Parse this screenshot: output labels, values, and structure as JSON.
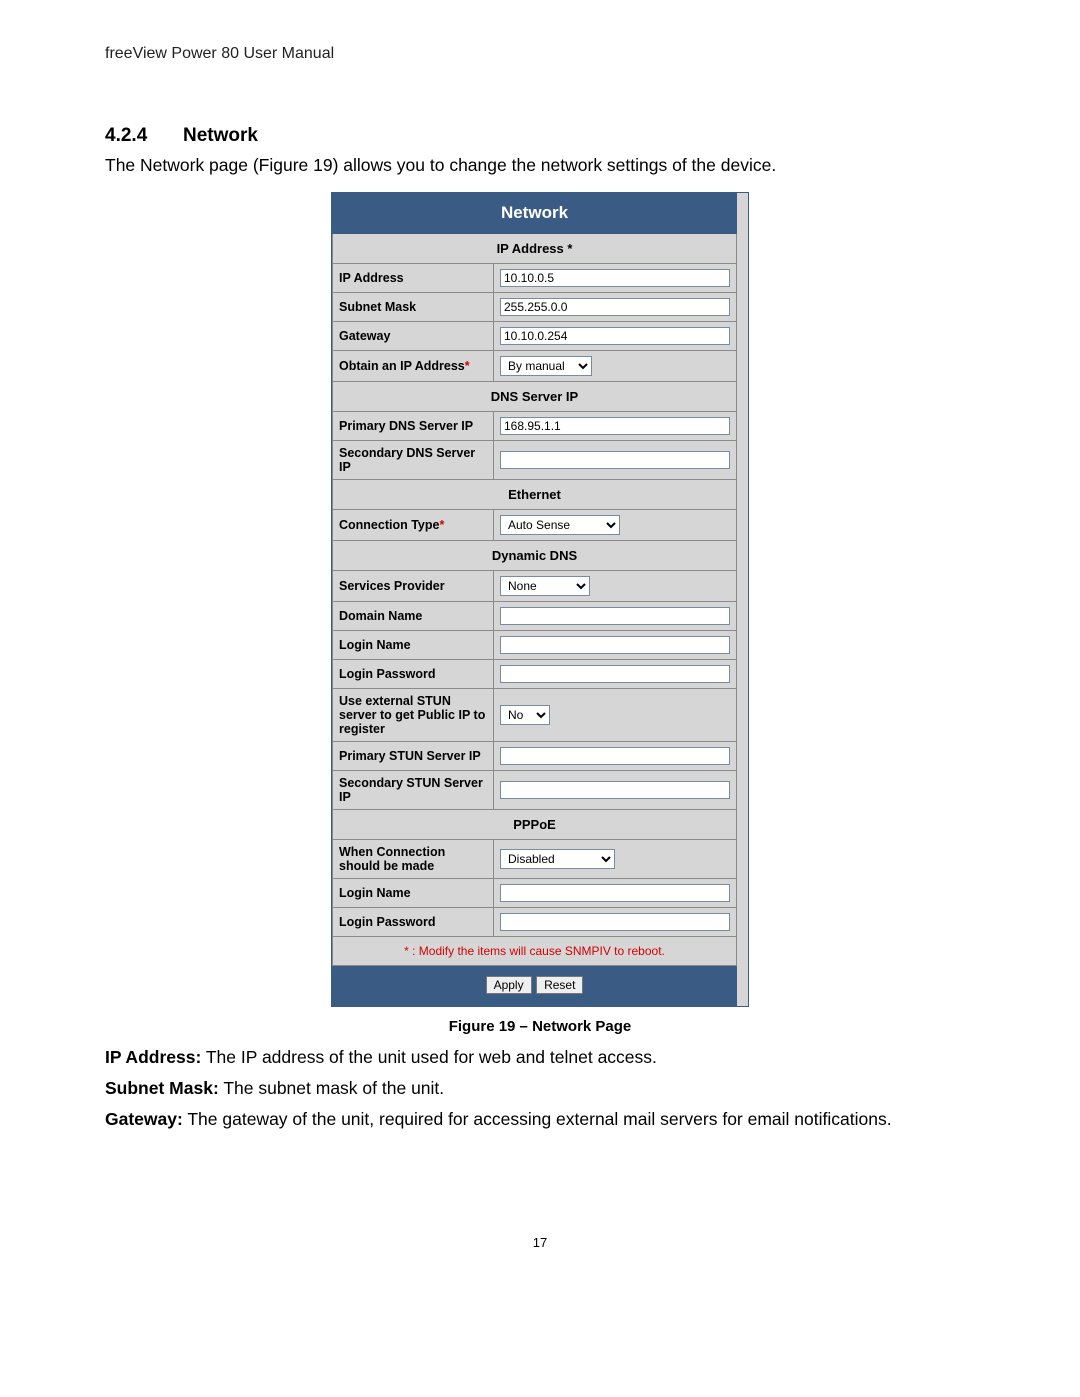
{
  "header": "freeView Power 80 User Manual",
  "section_number": "4.2.4",
  "section_title": "Network",
  "intro": "The Network page (Figure 19) allows you to change the network settings of the device.",
  "panel": {
    "title": "Network",
    "sections": {
      "ip": {
        "heading": "IP Address *",
        "rows": {
          "ip_address": {
            "label": "IP Address",
            "value": "10.10.0.5"
          },
          "subnet_mask": {
            "label": "Subnet Mask",
            "value": "255.255.0.0"
          },
          "gateway": {
            "label": "Gateway",
            "value": "10.10.0.254"
          },
          "obtain": {
            "label": "Obtain an IP Address",
            "value": "By manual"
          }
        }
      },
      "dns": {
        "heading": "DNS Server IP",
        "rows": {
          "primary": {
            "label": "Primary DNS Server IP",
            "value": "168.95.1.1"
          },
          "secondary": {
            "label": "Secondary DNS Server IP",
            "value": ""
          }
        }
      },
      "ethernet": {
        "heading": "Ethernet",
        "rows": {
          "connection_type": {
            "label": "Connection Type",
            "value": "Auto Sense"
          }
        }
      },
      "ddns": {
        "heading": "Dynamic DNS",
        "rows": {
          "provider": {
            "label": "Services Provider",
            "value": "None"
          },
          "domain": {
            "label": "Domain Name",
            "value": ""
          },
          "login": {
            "label": "Login Name",
            "value": ""
          },
          "password": {
            "label": "Login Password",
            "value": ""
          },
          "stun": {
            "label": "Use external STUN server to get Public IP to register",
            "value": "No"
          },
          "pstun": {
            "label": "Primary STUN Server IP",
            "value": ""
          },
          "sstun": {
            "label": "Secondary STUN Server IP",
            "value": ""
          }
        }
      },
      "pppoe": {
        "heading": "PPPoE",
        "rows": {
          "when": {
            "label": "When Connection should be made",
            "value": "Disabled"
          },
          "login": {
            "label": "Login Name",
            "value": ""
          },
          "password": {
            "label": "Login Password",
            "value": ""
          }
        }
      }
    },
    "note": "* : Modify the items will cause SNMPIV to reboot.",
    "buttons": {
      "apply": "Apply",
      "reset": "Reset"
    }
  },
  "caption": "Figure 19 – Network Page",
  "descriptions": {
    "ip_address": {
      "label": "IP Address:",
      "text": " The IP address of the unit used for web and telnet access."
    },
    "subnet_mask": {
      "label": "Subnet Mask:",
      "text": " The subnet mask of the unit."
    },
    "gateway": {
      "label": "Gateway:",
      "text": " The gateway of the unit, required for accessing external mail servers for email notifications."
    }
  },
  "page_number": "17"
}
